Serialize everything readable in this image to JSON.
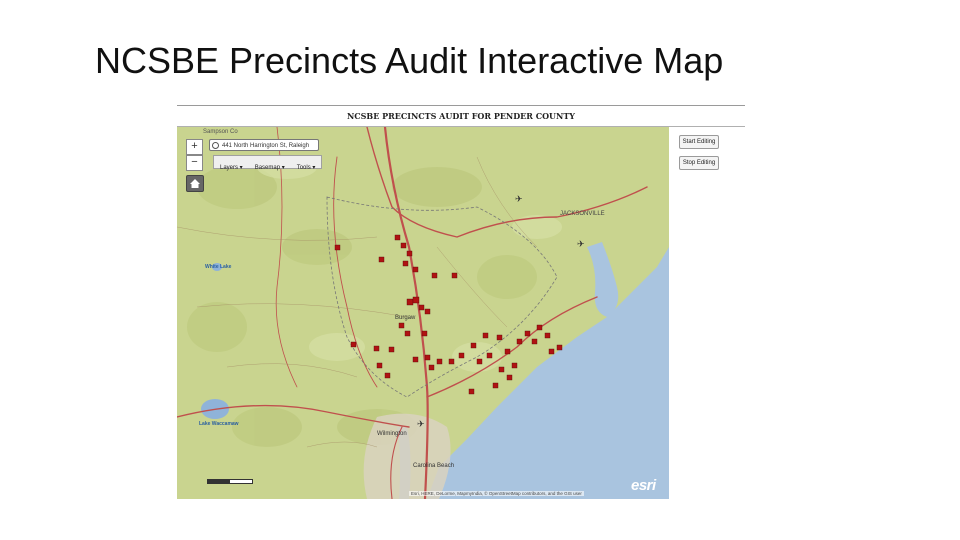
{
  "slide": {
    "title": "NCSBE Precincts Audit Interactive Map"
  },
  "app": {
    "header": "NCSBE PRECINCTS AUDIT FOR PENDER COUNTY",
    "buttons": {
      "start_editing": "Start Editing",
      "stop_editing": "Stop Editing"
    }
  },
  "map": {
    "zoom_in": "+",
    "zoom_out": "−",
    "search_value": "441 North Harrington St, Raleigh",
    "toolbar": {
      "layers": "Layers ▾",
      "basemap": "Basemap ▾",
      "tools": "Tools ▾"
    },
    "home_icon": "home-icon",
    "place_labels": {
      "lake_waccamaw": "Lake Waccamaw",
      "white_lake": "White Lake",
      "jacksonville": "JACKSONVILLE",
      "wilmington": "Wilmington",
      "carolina_beach": "Carolina Beach",
      "burgaw": "Burgaw",
      "sampson": "Sampson Co"
    },
    "attribution": "Esri, HERE, DeLorme, MapmyIndia, © OpenStreetMap contributors, and the GIS user",
    "logo": "esri",
    "colors": {
      "land": "#c9d48f",
      "water": "#a9c4df",
      "roads": "#c0504d",
      "precinct_marker": "#b01212"
    }
  }
}
